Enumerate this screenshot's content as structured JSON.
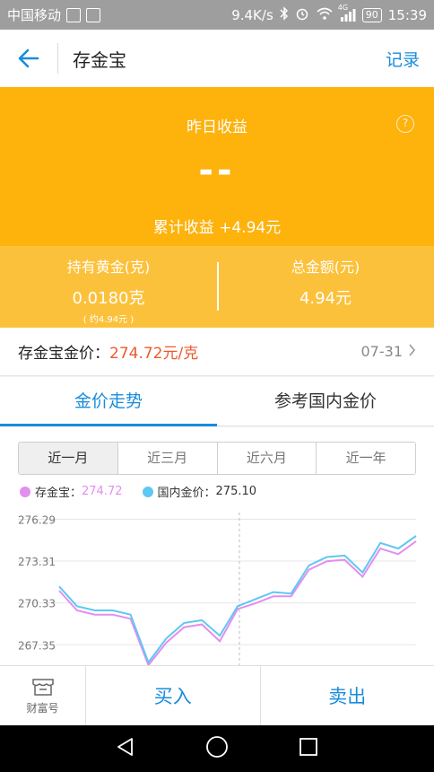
{
  "status_bar": {
    "carrier": "中国移动",
    "speed": "9.4K/s",
    "network": "4G",
    "battery": "90",
    "time": "15:39"
  },
  "header": {
    "title": "存金宝",
    "record_label": "记录"
  },
  "earnings": {
    "yesterday_label": "昨日收益",
    "yesterday_value": "--",
    "help_symbol": "?",
    "cumulative_text": "累计收益 +4.94元"
  },
  "holdings": {
    "gold_label": "持有黄金(克)",
    "gold_value": "0.0180克",
    "gold_sub": "( 约4.94元 )",
    "total_label": "总金额(元)",
    "total_value": "4.94元"
  },
  "price": {
    "label": "存金宝金价：",
    "value": "274.72元/克",
    "date": "07-31"
  },
  "tabs": [
    {
      "label": "金价走势"
    },
    {
      "label": "参考国内金价"
    }
  ],
  "ranges": [
    {
      "label": "近一月"
    },
    {
      "label": "近三月"
    },
    {
      "label": "近六月"
    },
    {
      "label": "近一年"
    }
  ],
  "legend": {
    "s1_label": "存金宝：",
    "s1_value": "274.72",
    "s2_label": "国内金价：",
    "s2_value": "275.10"
  },
  "colors": {
    "accent": "#1a8cdc",
    "orange": "#fdb20c",
    "orange_light": "#fcc13b",
    "price_red": "#ec5a2c",
    "series_pink": "#e48df0",
    "series_blue": "#5ec8f3"
  },
  "chart_data": {
    "type": "line",
    "y_ticks": [
      "276.29",
      "273.31",
      "270.33",
      "267.35"
    ],
    "ylim": [
      265.9,
      277.4
    ],
    "grid": true,
    "series": [
      {
        "name": "存金宝",
        "color": "#e48df0",
        "values": [
          271.2,
          269.8,
          269.5,
          269.5,
          269.2,
          265.9,
          267.5,
          268.6,
          268.8,
          267.6,
          269.9,
          270.3,
          270.8,
          270.8,
          272.7,
          273.3,
          273.4,
          272.2,
          274.2,
          273.8,
          274.72
        ]
      },
      {
        "name": "国内金价",
        "color": "#5ec8f3",
        "values": [
          271.5,
          270.1,
          269.8,
          269.8,
          269.5,
          266.1,
          267.8,
          268.9,
          269.1,
          268.0,
          270.1,
          270.6,
          271.1,
          271.0,
          273.0,
          273.6,
          273.7,
          272.5,
          274.6,
          274.2,
          275.1
        ]
      }
    ]
  },
  "bottom": {
    "wealth_label": "财富号",
    "buy_label": "买入",
    "sell_label": "卖出"
  }
}
